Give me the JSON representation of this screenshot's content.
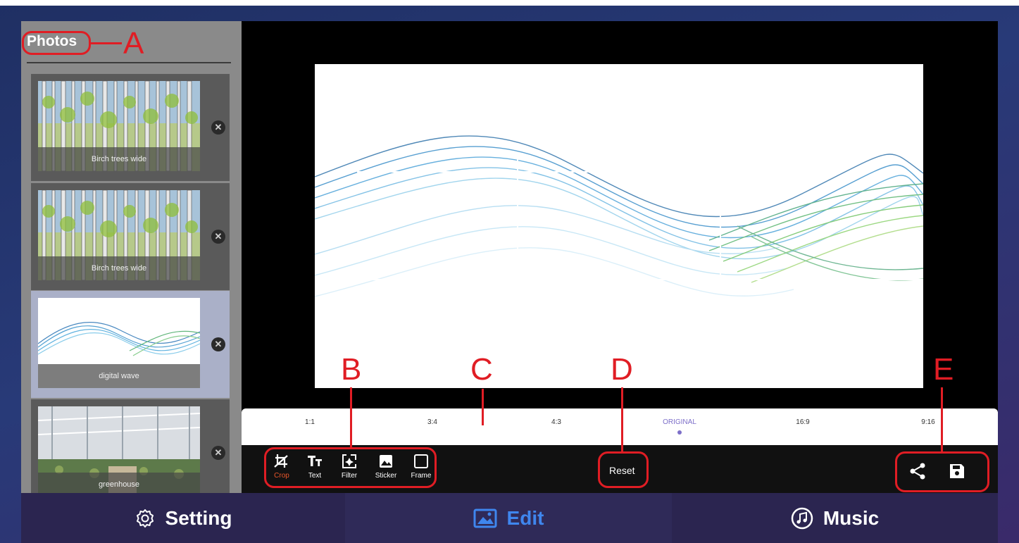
{
  "sidebar": {
    "title": "Photos",
    "photos": [
      {
        "caption": "Birch trees wide",
        "remove_icon": "close-icon"
      },
      {
        "caption": "Birch trees wide",
        "remove_icon": "close-icon"
      },
      {
        "caption": "digital wave",
        "remove_icon": "close-icon",
        "selected": true
      },
      {
        "caption": "greenhouse",
        "remove_icon": "close-icon"
      }
    ],
    "remove_glyph": "✕"
  },
  "ratios": [
    "1:1",
    "3:4",
    "4:3",
    "ORIGINAL",
    "16:9",
    "9:16"
  ],
  "active_ratio": "ORIGINAL",
  "tools": [
    {
      "label": "Crop",
      "icon": "crop-icon",
      "active": true
    },
    {
      "label": "Text",
      "icon": "text-icon"
    },
    {
      "label": "Filter",
      "icon": "filter-icon"
    },
    {
      "label": "Sticker",
      "icon": "sticker-icon"
    },
    {
      "label": "Frame",
      "icon": "frame-icon"
    }
  ],
  "reset_label": "Reset",
  "actions": [
    {
      "icon": "share-icon"
    },
    {
      "icon": "save-icon"
    }
  ],
  "annotations": [
    "A",
    "B",
    "C",
    "D",
    "E"
  ],
  "nav": {
    "tabs": [
      {
        "label": "Setting",
        "icon": "gear-icon"
      },
      {
        "label": "Edit",
        "icon": "image-icon",
        "active": true
      },
      {
        "label": "Music",
        "icon": "music-icon"
      }
    ]
  },
  "colors": {
    "accent": "#3f86ee",
    "active_tool": "#e9562a",
    "ratio_active": "#7d6fc9",
    "annotation": "#e01d24"
  }
}
